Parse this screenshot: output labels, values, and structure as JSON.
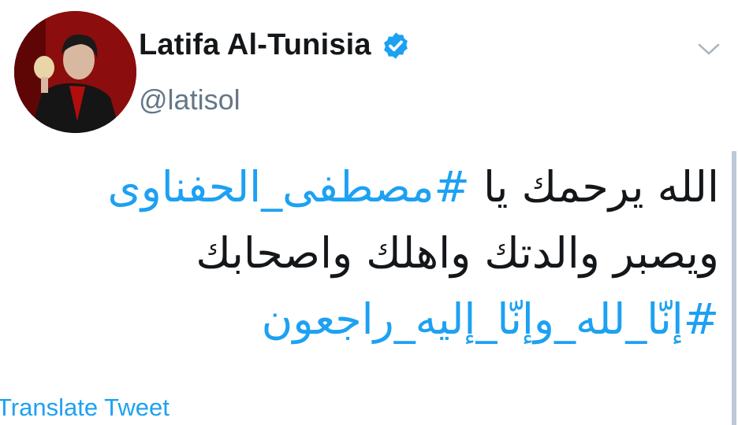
{
  "tweet": {
    "author": {
      "display_name": "Latifa Al-Tunisia",
      "handle": "@latisol",
      "verified": true,
      "avatar_icon": "profile-photo"
    },
    "text_lines": [
      {
        "plain": "الله يرحمك يا ",
        "hashtag": "#مصطفى_الحفناوى"
      },
      {
        "plain": "ويصبر والدتك واهلك واصحابك",
        "hashtag": ""
      },
      {
        "plain": "",
        "hashtag": "#إنّا_لله_وإنّا_إليه_راجعون"
      }
    ],
    "translate_label": "Translate Tweet",
    "menu_icon": "chevron-down-icon"
  },
  "colors": {
    "link": "#1da1f2",
    "text": "#14171a",
    "secondary": "#657786",
    "avatar_background": "#8c0d0d"
  }
}
